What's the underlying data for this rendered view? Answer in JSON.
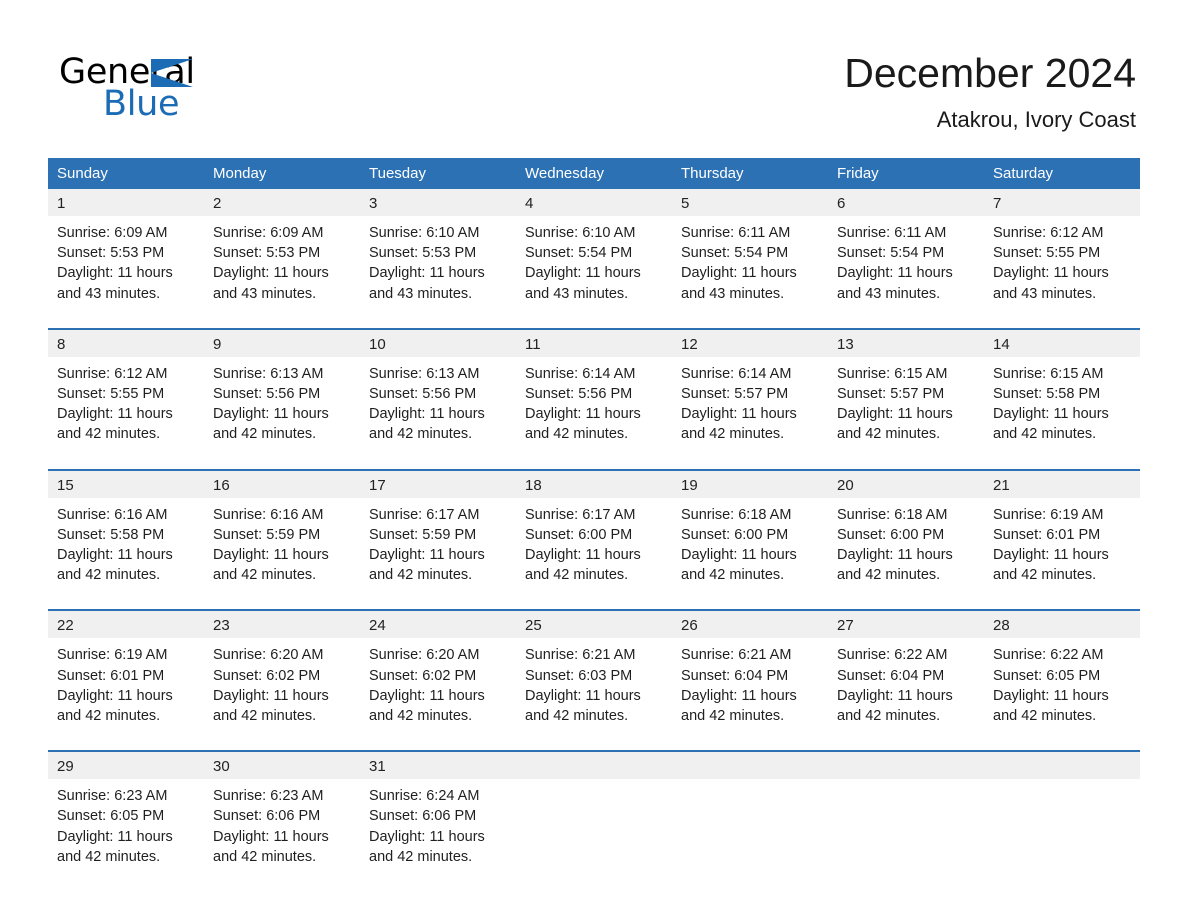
{
  "brand": {
    "name_top": "General",
    "name_bottom": "Blue",
    "accent_color": "#1b6cb5"
  },
  "header": {
    "title": "December 2024",
    "subtitle": "Atakrou, Ivory Coast"
  },
  "calendar": {
    "header_bg": "#2d71b5",
    "daynum_bg": "#f0f0f0",
    "weekday_headers": [
      "Sunday",
      "Monday",
      "Tuesday",
      "Wednesday",
      "Thursday",
      "Friday",
      "Saturday"
    ],
    "weeks": [
      [
        {
          "day": "1",
          "sunrise": "Sunrise: 6:09 AM",
          "sunset": "Sunset: 5:53 PM",
          "daylight": "Daylight: 11 hours and 43 minutes."
        },
        {
          "day": "2",
          "sunrise": "Sunrise: 6:09 AM",
          "sunset": "Sunset: 5:53 PM",
          "daylight": "Daylight: 11 hours and 43 minutes."
        },
        {
          "day": "3",
          "sunrise": "Sunrise: 6:10 AM",
          "sunset": "Sunset: 5:53 PM",
          "daylight": "Daylight: 11 hours and 43 minutes."
        },
        {
          "day": "4",
          "sunrise": "Sunrise: 6:10 AM",
          "sunset": "Sunset: 5:54 PM",
          "daylight": "Daylight: 11 hours and 43 minutes."
        },
        {
          "day": "5",
          "sunrise": "Sunrise: 6:11 AM",
          "sunset": "Sunset: 5:54 PM",
          "daylight": "Daylight: 11 hours and 43 minutes."
        },
        {
          "day": "6",
          "sunrise": "Sunrise: 6:11 AM",
          "sunset": "Sunset: 5:54 PM",
          "daylight": "Daylight: 11 hours and 43 minutes."
        },
        {
          "day": "7",
          "sunrise": "Sunrise: 6:12 AM",
          "sunset": "Sunset: 5:55 PM",
          "daylight": "Daylight: 11 hours and 43 minutes."
        }
      ],
      [
        {
          "day": "8",
          "sunrise": "Sunrise: 6:12 AM",
          "sunset": "Sunset: 5:55 PM",
          "daylight": "Daylight: 11 hours and 42 minutes."
        },
        {
          "day": "9",
          "sunrise": "Sunrise: 6:13 AM",
          "sunset": "Sunset: 5:56 PM",
          "daylight": "Daylight: 11 hours and 42 minutes."
        },
        {
          "day": "10",
          "sunrise": "Sunrise: 6:13 AM",
          "sunset": "Sunset: 5:56 PM",
          "daylight": "Daylight: 11 hours and 42 minutes."
        },
        {
          "day": "11",
          "sunrise": "Sunrise: 6:14 AM",
          "sunset": "Sunset: 5:56 PM",
          "daylight": "Daylight: 11 hours and 42 minutes."
        },
        {
          "day": "12",
          "sunrise": "Sunrise: 6:14 AM",
          "sunset": "Sunset: 5:57 PM",
          "daylight": "Daylight: 11 hours and 42 minutes."
        },
        {
          "day": "13",
          "sunrise": "Sunrise: 6:15 AM",
          "sunset": "Sunset: 5:57 PM",
          "daylight": "Daylight: 11 hours and 42 minutes."
        },
        {
          "day": "14",
          "sunrise": "Sunrise: 6:15 AM",
          "sunset": "Sunset: 5:58 PM",
          "daylight": "Daylight: 11 hours and 42 minutes."
        }
      ],
      [
        {
          "day": "15",
          "sunrise": "Sunrise: 6:16 AM",
          "sunset": "Sunset: 5:58 PM",
          "daylight": "Daylight: 11 hours and 42 minutes."
        },
        {
          "day": "16",
          "sunrise": "Sunrise: 6:16 AM",
          "sunset": "Sunset: 5:59 PM",
          "daylight": "Daylight: 11 hours and 42 minutes."
        },
        {
          "day": "17",
          "sunrise": "Sunrise: 6:17 AM",
          "sunset": "Sunset: 5:59 PM",
          "daylight": "Daylight: 11 hours and 42 minutes."
        },
        {
          "day": "18",
          "sunrise": "Sunrise: 6:17 AM",
          "sunset": "Sunset: 6:00 PM",
          "daylight": "Daylight: 11 hours and 42 minutes."
        },
        {
          "day": "19",
          "sunrise": "Sunrise: 6:18 AM",
          "sunset": "Sunset: 6:00 PM",
          "daylight": "Daylight: 11 hours and 42 minutes."
        },
        {
          "day": "20",
          "sunrise": "Sunrise: 6:18 AM",
          "sunset": "Sunset: 6:00 PM",
          "daylight": "Daylight: 11 hours and 42 minutes."
        },
        {
          "day": "21",
          "sunrise": "Sunrise: 6:19 AM",
          "sunset": "Sunset: 6:01 PM",
          "daylight": "Daylight: 11 hours and 42 minutes."
        }
      ],
      [
        {
          "day": "22",
          "sunrise": "Sunrise: 6:19 AM",
          "sunset": "Sunset: 6:01 PM",
          "daylight": "Daylight: 11 hours and 42 minutes."
        },
        {
          "day": "23",
          "sunrise": "Sunrise: 6:20 AM",
          "sunset": "Sunset: 6:02 PM",
          "daylight": "Daylight: 11 hours and 42 minutes."
        },
        {
          "day": "24",
          "sunrise": "Sunrise: 6:20 AM",
          "sunset": "Sunset: 6:02 PM",
          "daylight": "Daylight: 11 hours and 42 minutes."
        },
        {
          "day": "25",
          "sunrise": "Sunrise: 6:21 AM",
          "sunset": "Sunset: 6:03 PM",
          "daylight": "Daylight: 11 hours and 42 minutes."
        },
        {
          "day": "26",
          "sunrise": "Sunrise: 6:21 AM",
          "sunset": "Sunset: 6:04 PM",
          "daylight": "Daylight: 11 hours and 42 minutes."
        },
        {
          "day": "27",
          "sunrise": "Sunrise: 6:22 AM",
          "sunset": "Sunset: 6:04 PM",
          "daylight": "Daylight: 11 hours and 42 minutes."
        },
        {
          "day": "28",
          "sunrise": "Sunrise: 6:22 AM",
          "sunset": "Sunset: 6:05 PM",
          "daylight": "Daylight: 11 hours and 42 minutes."
        }
      ],
      [
        {
          "day": "29",
          "sunrise": "Sunrise: 6:23 AM",
          "sunset": "Sunset: 6:05 PM",
          "daylight": "Daylight: 11 hours and 42 minutes."
        },
        {
          "day": "30",
          "sunrise": "Sunrise: 6:23 AM",
          "sunset": "Sunset: 6:06 PM",
          "daylight": "Daylight: 11 hours and 42 minutes."
        },
        {
          "day": "31",
          "sunrise": "Sunrise: 6:24 AM",
          "sunset": "Sunset: 6:06 PM",
          "daylight": "Daylight: 11 hours and 42 minutes."
        },
        {
          "day": "",
          "sunrise": "",
          "sunset": "",
          "daylight": ""
        },
        {
          "day": "",
          "sunrise": "",
          "sunset": "",
          "daylight": ""
        },
        {
          "day": "",
          "sunrise": "",
          "sunset": "",
          "daylight": ""
        },
        {
          "day": "",
          "sunrise": "",
          "sunset": "",
          "daylight": ""
        }
      ]
    ]
  }
}
